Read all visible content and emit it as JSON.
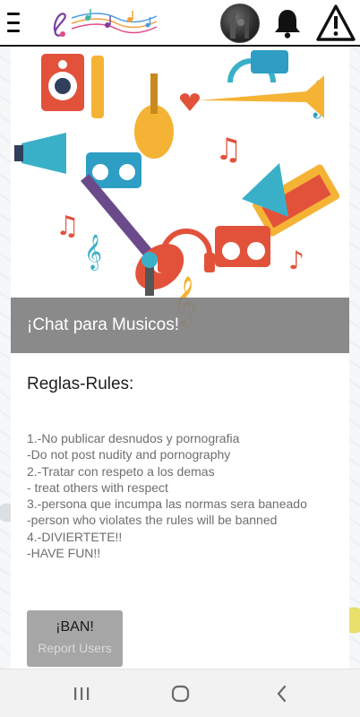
{
  "header": {
    "menu_icon": "hamburger-icon",
    "logo_icon": "music-notes-logo",
    "avatar_icon": "user-avatar",
    "notification_icon": "bell-icon",
    "report_icon": "warning-triangle-icon"
  },
  "chat": {
    "title": "¡Chat para Musicos!",
    "rules_heading": "Reglas-Rules:",
    "rules_text": "1.-No publicar desnudos y pornografia\n-Do not post nudity and pornography\n2.-Tratar con respeto a los demas\n- treat others with respect\n3.-persona que incumpa las normas sera baneado\n-person who violates the rules will be banned\n4.-DIVIERTETE!!\n-HAVE FUN!!",
    "ban_button": {
      "title": "¡BAN!",
      "subtitle": "Report Users"
    }
  },
  "system_nav": {
    "recents_icon": "recents-icon",
    "home_icon": "home-icon",
    "back_icon": "back-icon"
  },
  "colors": {
    "caption_bg": "#808080",
    "button_bg": "#a6a6a6",
    "rules_text": "#6e6e6e"
  }
}
